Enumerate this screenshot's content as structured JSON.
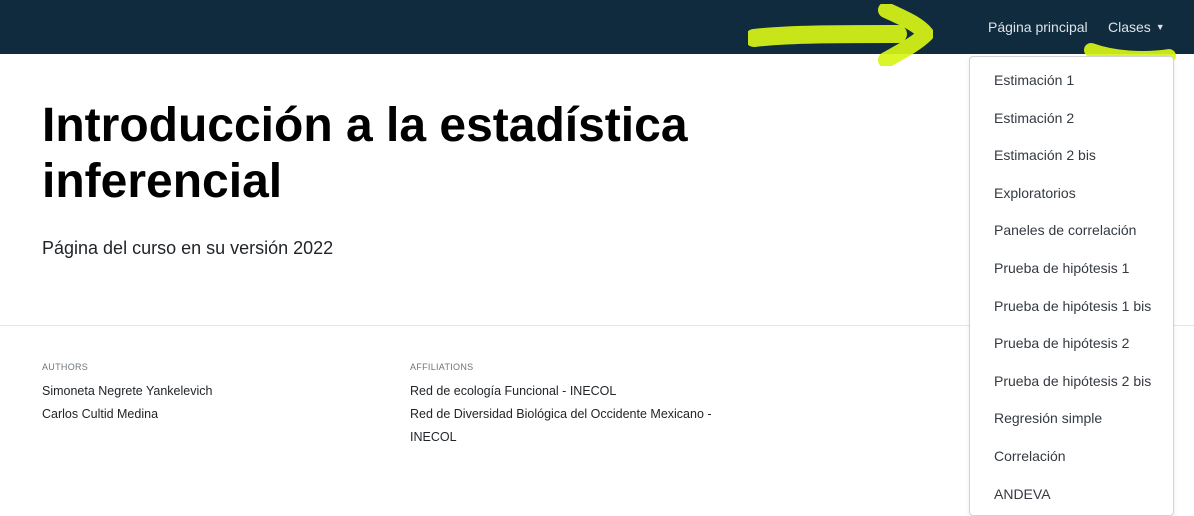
{
  "navbar": {
    "home_label": "Página principal",
    "classes_label": "Clases",
    "caret": "▼",
    "background": "#102a3e"
  },
  "annotations": {
    "highlight_color": "#d8f516"
  },
  "header": {
    "title": "Introducción a la estadística inferencial",
    "subtitle": "Página del curso en su versión 2022"
  },
  "meta": {
    "authors_label": "AUTHORS",
    "authors": [
      "Simoneta Negrete Yankelevich",
      "Carlos Cultid Medina"
    ],
    "affiliations_label": "AFFILIATIONS",
    "affiliations": [
      "Red de ecología Funcional - INECOL",
      "Red de Diversidad Biológica del Occidente Mexicano - INECOL"
    ]
  },
  "dropdown": {
    "items": [
      "Estimación 1",
      "Estimación 2",
      "Estimación 2 bis",
      "Exploratorios",
      "Paneles de correlación",
      "Prueba de hipótesis 1",
      "Prueba de hipótesis 1 bis",
      "Prueba de hipótesis 2",
      "Prueba de hipótesis 2 bis",
      "Regresión simple",
      "Correlación",
      "ANDEVA"
    ]
  }
}
